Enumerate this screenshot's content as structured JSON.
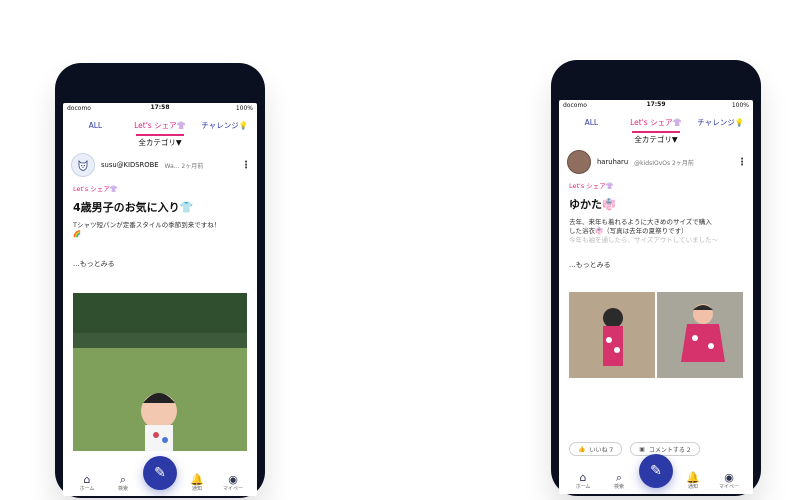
{
  "phones": {
    "left": {
      "status": {
        "carrier": "docomo",
        "time": "17:58",
        "battery": "100%"
      },
      "tabs": [
        {
          "label": "ALL"
        },
        {
          "label": "Let's シェア👚"
        },
        {
          "label": "チャレンジ💡"
        }
      ],
      "category_dropdown": {
        "label": "全カテゴリ▼"
      },
      "post": {
        "avatar_icon": "cat-avatar-icon",
        "username": "susu@KIDSROBE",
        "meta": "Wa...  2ヶ月前",
        "tag": "Let's シェア👚",
        "title": "4歳男子のお気に入り👕",
        "body_line1": "Tシャツ短パンが定番スタイルの季節到来ですね！",
        "body_line2": "🌈",
        "faded_line": "",
        "more_label": "...もっとみる"
      },
      "bottom_nav": [
        {
          "icon": "home-icon",
          "label": "ホーム"
        },
        {
          "icon": "search-icon",
          "label": "検索"
        },
        {
          "icon": "notification-icon",
          "label": "通知"
        },
        {
          "icon": "account-icon",
          "label": "マイペー"
        }
      ]
    },
    "right": {
      "status": {
        "carrier": "docomo",
        "time": "17:59",
        "battery": "100%"
      },
      "tabs": [
        {
          "label": "ALL"
        },
        {
          "label": "Let's シェア👚"
        },
        {
          "label": "チャレンジ💡"
        }
      ],
      "category_dropdown": {
        "label": "全カテゴリ▼"
      },
      "post": {
        "avatar_icon": "user-avatar-icon",
        "username": "haruharu",
        "meta": "@kidsIOvOs  2ヶ月前",
        "tag": "Let's シェア👚",
        "title": "ゆかた👘",
        "body_line1": "去年、来年も着れるように大きめのサイズで購入",
        "body_line2": "した浴衣👘（写真は去年の夏祭りです）",
        "faded_line": "今年も袖を通したら、サイズアウトしていました〜",
        "more_label": "...もっとみる"
      },
      "actions": [
        {
          "icon": "thumbs-up-icon",
          "label": "いいね 7"
        },
        {
          "icon": "comment-icon",
          "label": "コメントする 2"
        }
      ],
      "bottom_nav": [
        {
          "icon": "home-icon",
          "label": "ホーム"
        },
        {
          "icon": "search-icon",
          "label": "検索"
        },
        {
          "icon": "notification-icon",
          "label": "通知"
        },
        {
          "icon": "account-icon",
          "label": "マイペー"
        }
      ]
    }
  }
}
